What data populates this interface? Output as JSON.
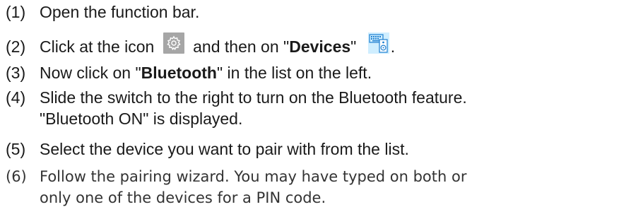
{
  "steps": [
    {
      "num": "(1)",
      "text": "Open the function bar."
    },
    {
      "num": "(2)",
      "before": "Click at the icon",
      "middle": "and then on \"",
      "bold": "Devices",
      "after": "\"",
      "end": "."
    },
    {
      "num": "(3)",
      "before": "Now click on \"",
      "bold": "Bluetooth",
      "after": "\" in the list on the left."
    },
    {
      "num": "(4)",
      "text": "Slide the switch to the right to turn on the Bluetooth feature.",
      "cont": "\"Bluetooth ON\" is displayed."
    },
    {
      "num": "(5)",
      "text": "Select the device you want to pair with from the list."
    },
    {
      "num": "(6)",
      "text": "Follow the pairing wizard. You may have typed on both or",
      "cont": "only one of the devices for a PIN code."
    }
  ],
  "icons": {
    "settings": "gear-icon",
    "devices": "devices-icon"
  },
  "colors": {
    "text": "#1a1a1a",
    "gear_bg": "#a6a6a6",
    "devices_bg": "#cfeeff",
    "devices_accent": "#1e7fd0"
  }
}
